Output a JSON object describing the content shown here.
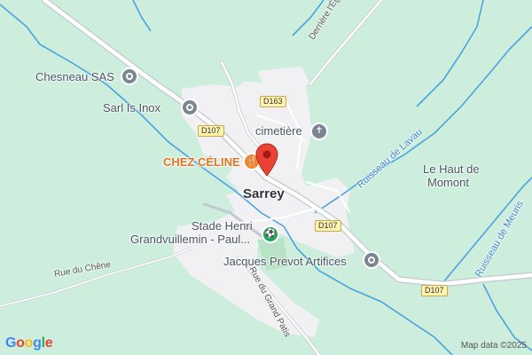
{
  "map": {
    "town_name": "Sarrey",
    "places": {
      "chesneau": "Chesneau SAS",
      "sarl_inox": "Sarl Is Inox",
      "cimetiere": "cimetière",
      "chez_celine": "CHEZ CÉLINE",
      "stade_line1": "Stade Henri",
      "stade_line2": "Grandvuillemin - Paul...",
      "jacques_prevot": "Jacques Prevot Artifices",
      "haut_momont_line1": "Le Haut de",
      "haut_momont_line2": "Momont"
    },
    "streets": {
      "derriere_eglise": "Derrière l'Église",
      "rue_chene": "Rue du Chêne",
      "rue_grand_patis": "Rue du Grand Patis"
    },
    "waterways": {
      "ruisseau_lavau": "Ruisseau de Lavau",
      "ruisseau_meurisse": "Ruisseau de Meuris"
    },
    "road_shields": {
      "d163": "D163",
      "d107_west": "D107",
      "d107_center": "D107",
      "d107_east": "D107"
    },
    "attribution": {
      "logo": "Google",
      "map_data": "Map data ©2025"
    },
    "colors": {
      "background": "#cdeedd",
      "water": "#4aa3df",
      "road": "#aeb6bf",
      "built_area": "#f1f0f3",
      "pin": "#ea4335"
    },
    "icons": {
      "poi_company": "business-icon",
      "poi_restaurant": "restaurant-icon",
      "poi_cemetery": "cemetery-icon",
      "poi_stadium": "stadium-icon",
      "pin": "location-pin-icon"
    }
  }
}
